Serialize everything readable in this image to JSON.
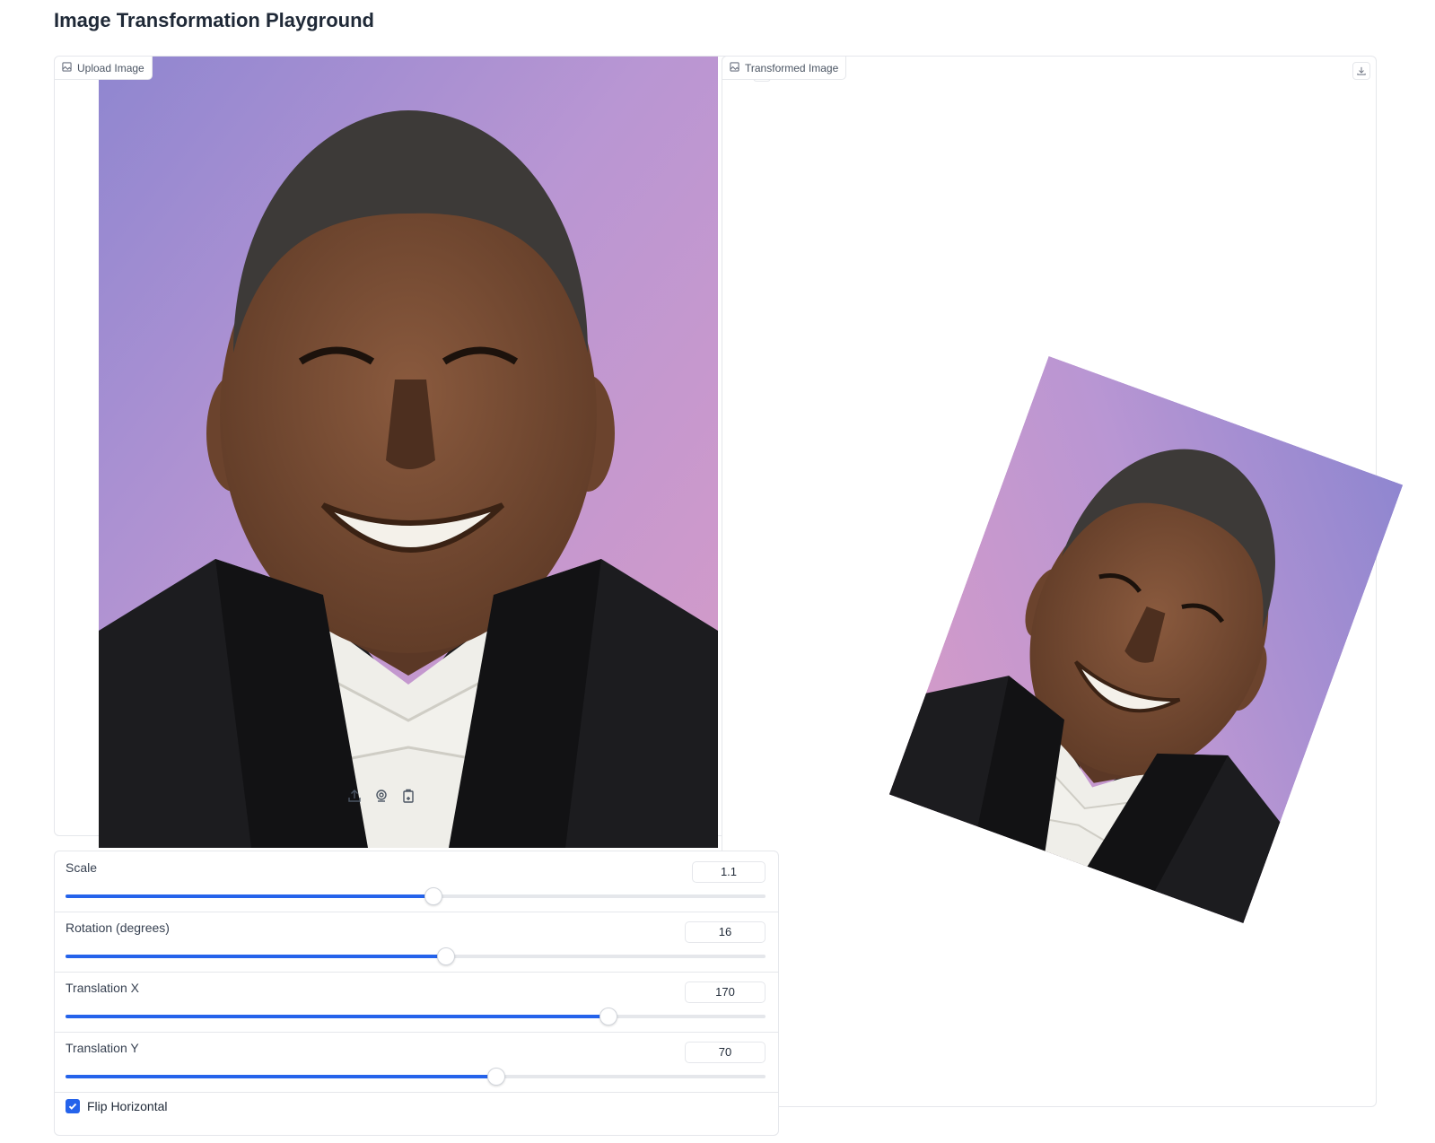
{
  "app": {
    "title": "Image Transformation Playground"
  },
  "upload_panel": {
    "label": "Upload Image",
    "clear_label": "×"
  },
  "output_panel": {
    "label": "Transformed Image"
  },
  "source_toolbar": {
    "icons": [
      "upload-icon",
      "webcam-icon",
      "clipboard-icon"
    ]
  },
  "controls": {
    "sliders": [
      {
        "label": "Scale",
        "value": "1.1",
        "fraction": 0.525
      },
      {
        "label": "Rotation (degrees)",
        "value": "16",
        "fraction": 0.543
      },
      {
        "label": "Translation X",
        "value": "170",
        "fraction": 0.775
      },
      {
        "label": "Translation Y",
        "value": "70",
        "fraction": 0.615
      }
    ],
    "flip_horizontal": {
      "label": "Flip Horizontal",
      "checked": true
    }
  },
  "colors": {
    "accent": "#2563eb",
    "border": "#e5e7eb",
    "photo_bg_top": "#8f86d0",
    "photo_bg_bottom": "#d89bc7"
  }
}
